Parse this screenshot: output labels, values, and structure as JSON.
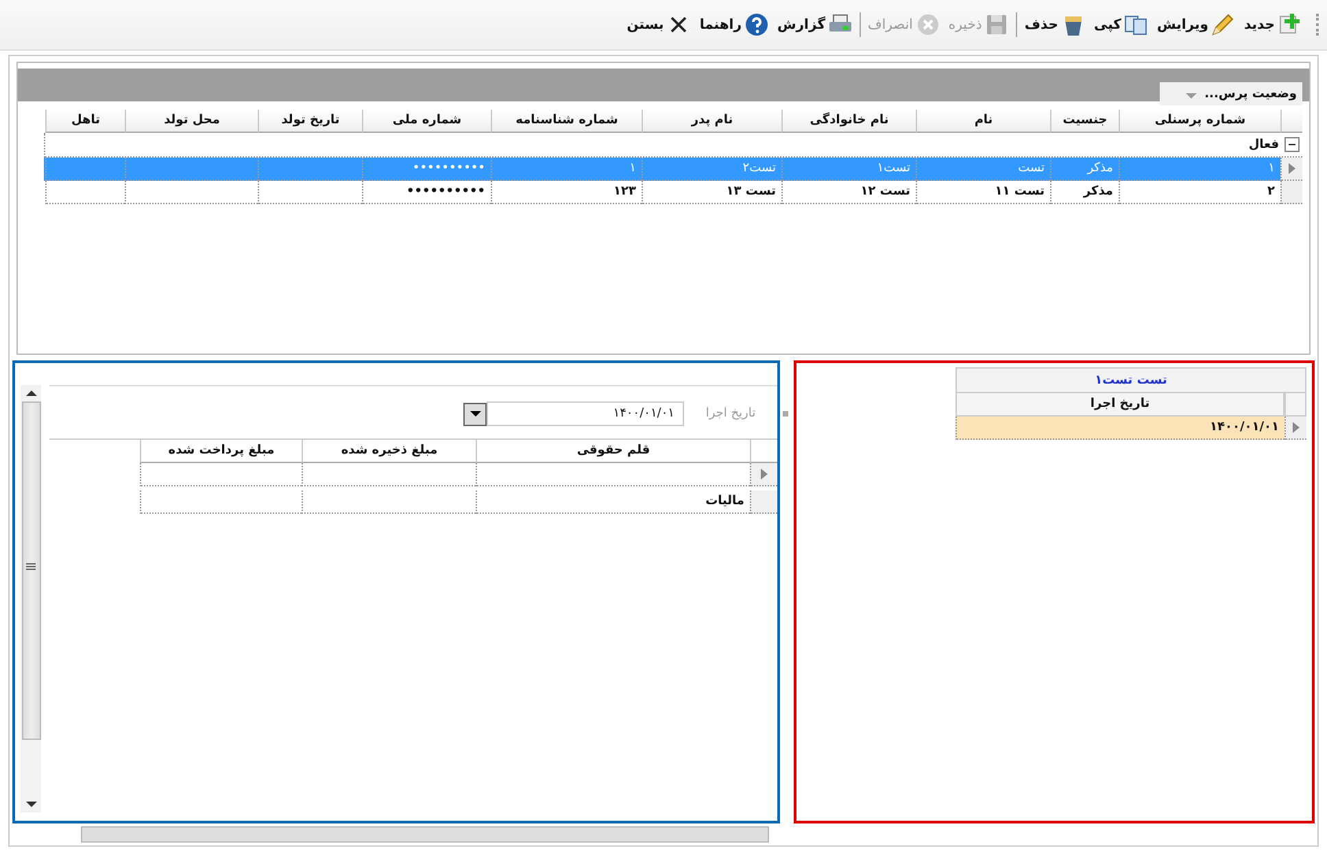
{
  "toolbar": [
    {
      "kind": "button",
      "label": "جدید",
      "disabled": false
    },
    {
      "kind": "button",
      "label": "ویرایش",
      "disabled": false
    },
    {
      "kind": "button",
      "label": "کپی",
      "disabled": false
    },
    {
      "kind": "button",
      "label": "حذف",
      "disabled": false
    },
    {
      "kind": "separator"
    },
    {
      "kind": "button",
      "label": "ذخیره",
      "disabled": true
    },
    {
      "kind": "button",
      "label": "انصراف",
      "disabled": true
    },
    {
      "kind": "separator"
    },
    {
      "kind": "button",
      "label": "گزارش",
      "disabled": false
    },
    {
      "kind": "button",
      "label": "راهنما",
      "disabled": false
    },
    {
      "kind": "button",
      "label": "بستن",
      "disabled": false
    }
  ],
  "main_grid": {
    "filter": "وضعیت پرس...",
    "columns": [
      "شماره پرسنلی",
      "جنسیت",
      "نام",
      "نام خانوادگی",
      "نام پدر",
      "شماره شناسنامه",
      "شماره ملی",
      "تاریخ تولد",
      "محل تولد",
      "تاهل"
    ],
    "groups": [
      {
        "label": "فعال",
        "expanded": true,
        "rows": [
          {
            "selected": true,
            "cells": [
              "۱",
              "مذکر",
              "تست",
              "تست۱",
              "تست۲",
              "۱",
              "••••••••••"
            ]
          },
          {
            "selected": false,
            "cells": [
              "۲",
              "مذکر",
              "تست ۱۱",
              "تست ۱۲",
              "تست ۱۳",
              "۱۲۳",
              "••••••••••"
            ]
          }
        ]
      }
    ]
  },
  "history_grid": {
    "title": "تست تست۱",
    "columns": [
      "تاریخ اجرا"
    ],
    "rows": [
      {
        "selected": true,
        "cells": [
          "۱۴۰۰/۰۱/۰۱"
        ]
      }
    ]
  },
  "detail": {
    "date_label": "تاریخ اجرا",
    "date_value": "۱۴۰۰/۰۱/۰۱",
    "columns": [
      "قلم حقوقی",
      "مبلغ ذخیره شده",
      "مبلغ پرداخت شده"
    ],
    "rows": [
      {
        "kind": "new"
      },
      {
        "kind": "total",
        "cells": [
          "مالیات"
        ]
      }
    ]
  }
}
